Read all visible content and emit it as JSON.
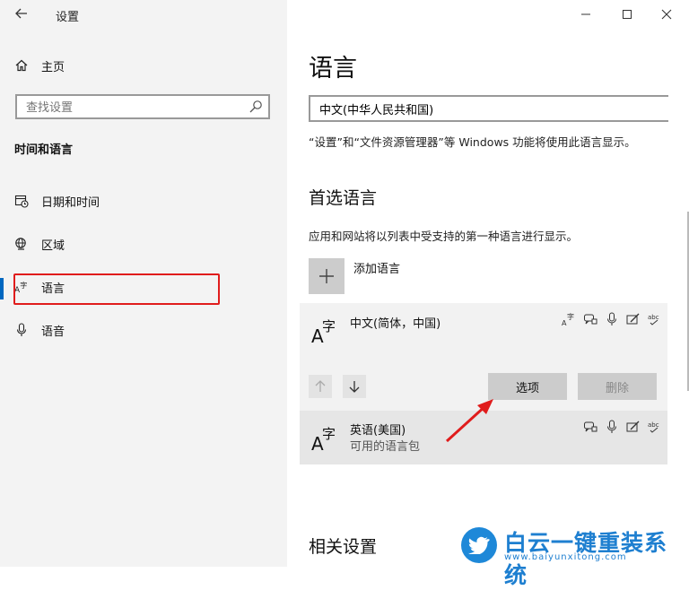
{
  "window": {
    "title": "设置"
  },
  "sidebar": {
    "home_label": "主页",
    "search": {
      "placeholder": "查找设置",
      "value": ""
    },
    "section_title": "时间和语言",
    "items": [
      {
        "label": "日期和时间",
        "icon": "calendar-clock-icon"
      },
      {
        "label": "区域",
        "icon": "globe-icon"
      },
      {
        "label": "语言",
        "icon": "language-icon",
        "selected": true
      },
      {
        "label": "语音",
        "icon": "microphone-icon"
      }
    ]
  },
  "main": {
    "title": "语言",
    "display_language": {
      "value": "中文(中华人民共和国)",
      "note": "“设置”和“文件资源管理器”等 Windows 功能将使用此语言显示。"
    },
    "preferred": {
      "title": "首选语言",
      "description": "应用和网站将以列表中受支持的第一种语言进行显示。",
      "add_label": "添加语言",
      "languages": [
        {
          "name": "中文(简体，中国)",
          "subtitle": ""
        },
        {
          "name": "英语(美国)",
          "subtitle": "可用的语言包"
        }
      ],
      "options_label": "选项",
      "remove_label": "删除"
    },
    "related_title": "相关设置"
  },
  "watermark": {
    "text": "白云一键重装系统",
    "url": "www.baiyunxitong.com"
  },
  "colors": {
    "accent": "#0067c0",
    "annotation": "#e01c1c",
    "watermark": "#1e88d8"
  }
}
